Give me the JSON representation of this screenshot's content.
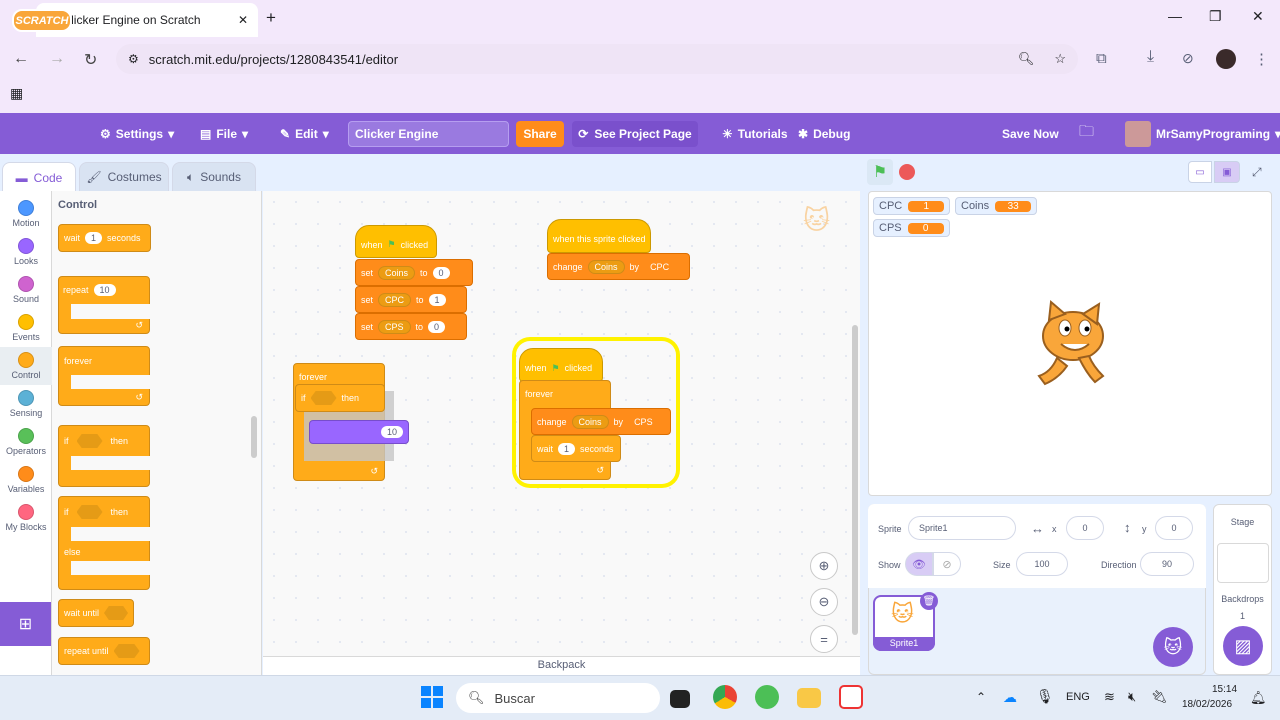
{
  "browser": {
    "tab_title": "Clicker Engine on Scratch",
    "url": "scratch.mit.edu/projects/1280843541/editor"
  },
  "menu": {
    "logo": "SCRATCH",
    "settings": "Settings",
    "file": "File",
    "edit": "Edit",
    "project_title": "Clicker Engine",
    "share": "Share",
    "see_project": "See Project Page",
    "tutorials": "Tutorials",
    "debug": "Debug",
    "save_now": "Save Now",
    "username": "MrSamyPrograming"
  },
  "tabs": {
    "code": "Code",
    "costumes": "Costumes",
    "sounds": "Sounds"
  },
  "categories": [
    {
      "label": "Motion",
      "color": "#4c97ff"
    },
    {
      "label": "Looks",
      "color": "#9966ff"
    },
    {
      "label": "Sound",
      "color": "#cf63cf"
    },
    {
      "label": "Events",
      "color": "#ffbf00"
    },
    {
      "label": "Control",
      "color": "#ffab19"
    },
    {
      "label": "Sensing",
      "color": "#5cb1d6"
    },
    {
      "label": "Operators",
      "color": "#59c059"
    },
    {
      "label": "Variables",
      "color": "#ff8c1a"
    },
    {
      "label": "My Blocks",
      "color": "#ff6680"
    }
  ],
  "palette": {
    "heading": "Control",
    "wait": "wait",
    "wait_val": "1",
    "seconds": "seconds",
    "repeat": "repeat",
    "repeat_val": "10",
    "forever": "forever",
    "if": "if",
    "then": "then",
    "else": "else",
    "wait_until": "wait until",
    "repeat_until": "repeat until"
  },
  "scripts": {
    "s1": {
      "hat": "when",
      "clicked": "clicked",
      "set": "set",
      "to": "to",
      "v1": "Coins",
      "n1": "0",
      "v2": "CPC",
      "n2": "1",
      "v3": "CPS",
      "n3": "0"
    },
    "s2": {
      "hat": "when this sprite clicked",
      "change": "change",
      "var": "Coins",
      "by": "by",
      "val": "CPC"
    },
    "s3": {
      "forever": "forever",
      "if": "if",
      "then": "then",
      "num": "10"
    },
    "s4": {
      "hat": "when",
      "clicked": "clicked",
      "forever": "forever",
      "change": "change",
      "var": "Coins",
      "by": "by",
      "val": "CPS",
      "wait": "wait",
      "wait_val": "1",
      "seconds": "seconds"
    },
    "backpack": "Backpack"
  },
  "monitors": [
    {
      "name": "CPC",
      "value": "1"
    },
    {
      "name": "Coins",
      "value": "33"
    },
    {
      "name": "CPS",
      "value": "0"
    }
  ],
  "sprite_info": {
    "sprite_label": "Sprite",
    "sprite_name": "Sprite1",
    "x_label": "x",
    "x": "0",
    "y_label": "y",
    "y": "0",
    "show_label": "Show",
    "size_label": "Size",
    "size": "100",
    "direction_label": "Direction",
    "direction": "90"
  },
  "sprite_list": [
    {
      "name": "Sprite1"
    }
  ],
  "stage_pane": {
    "title": "Stage",
    "backdrops_label": "Backdrops",
    "backdrops_count": "1"
  },
  "taskbar": {
    "search": "Buscar",
    "lang": "ENG",
    "time": "15:14",
    "date": "18/02/2026"
  }
}
